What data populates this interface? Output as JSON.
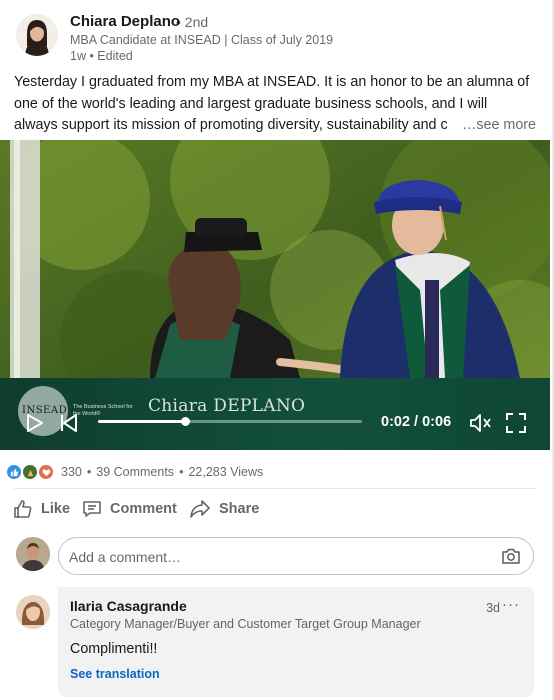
{
  "author": {
    "name": "Chiara Deplano",
    "degree": "• 2nd",
    "headline": "MBA Candidate at INSEAD  |  Class of July 2019",
    "time": "1w • Edited"
  },
  "post": {
    "lines": [
      "Yesterday I graduated from my MBA at INSEAD. It is an honor to be an alumna of",
      "one of the world's leading and largest graduate business schools, and I will",
      "always support its mission of promoting diversity, sustainability and c"
    ],
    "see_more": "…see more"
  },
  "video": {
    "logo_text": "INSEAD",
    "school_tagline": "The Business School for the World®",
    "graduate_name": "Chiara DEPLANO",
    "time_display": "0:02 / 0:06",
    "progress": 0.33
  },
  "social": {
    "reactions": [
      "like-reaction",
      "celebrate-reaction",
      "love-reaction"
    ],
    "reaction_count": "330",
    "comments": "39 Comments",
    "views": "22,283 Views",
    "separator": "•"
  },
  "actions": {
    "like": "Like",
    "comment": "Comment",
    "share": "Share"
  },
  "comment_box": {
    "placeholder": "Add a comment…"
  },
  "comment": {
    "name": "Ilaria Casagrande",
    "title": "Category Manager/Buyer and Customer Target Group Manager",
    "time": "3d",
    "more": "···",
    "text": "Complimenti!!",
    "translation": "See translation"
  },
  "colors": {
    "link_blue": "#0a66c2",
    "lower_third_green": "#12503c"
  }
}
